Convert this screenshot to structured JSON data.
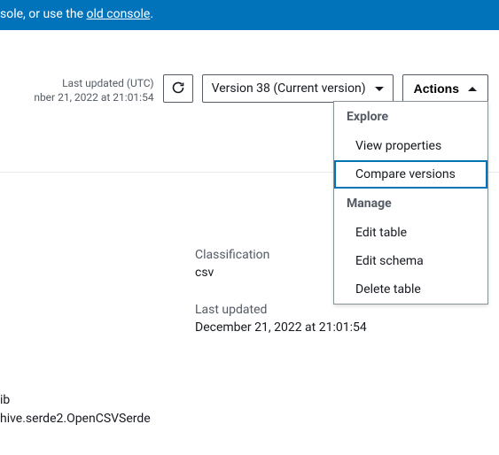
{
  "banner": {
    "prefix": "sole, or use the ",
    "link": "old console",
    "suffix": "."
  },
  "header": {
    "last_updated_label": "Last updated (UTC)",
    "last_updated_value": "nber 21, 2022 at 21:01:54",
    "version_label": "Version 38 (Current version)",
    "actions_label": "Actions"
  },
  "dropdown": {
    "section_explore": "Explore",
    "view_properties": "View properties",
    "compare_versions": "Compare versions",
    "section_manage": "Manage",
    "edit_table": "Edit table",
    "edit_schema": "Edit schema",
    "delete_table": "Delete table"
  },
  "details": {
    "classification_label": "Classification",
    "classification_value": "csv",
    "last_updated_label": "Last updated",
    "last_updated_value": "December 21, 2022 at 21:01:54"
  },
  "bottom": {
    "line1": "ib",
    "line2": "hive.serde2.OpenCSVSerde"
  }
}
